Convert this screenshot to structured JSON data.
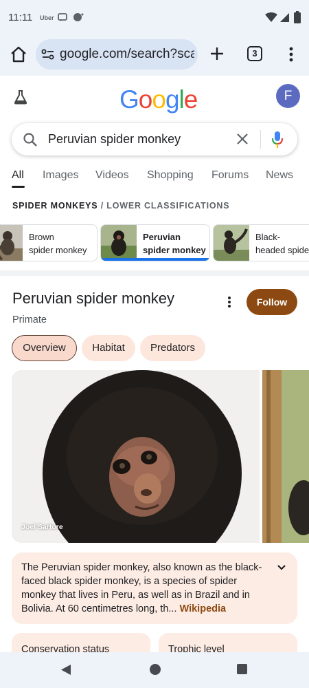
{
  "status_bar": {
    "time": "11:11",
    "app": "Uber"
  },
  "browser": {
    "url": "google.com/search?sca_",
    "tab_count": "3"
  },
  "logo": {
    "letters": [
      {
        "ch": "G",
        "color": "#4285f4"
      },
      {
        "ch": "o",
        "color": "#ea4335"
      },
      {
        "ch": "o",
        "color": "#fbbc05"
      },
      {
        "ch": "g",
        "color": "#4285f4"
      },
      {
        "ch": "l",
        "color": "#34a853"
      },
      {
        "ch": "e",
        "color": "#ea4335"
      }
    ]
  },
  "account": {
    "initial": "F"
  },
  "search": {
    "query": "Peruvian spider monkey"
  },
  "tabs": [
    "All",
    "Images",
    "Videos",
    "Shopping",
    "Forums",
    "News"
  ],
  "breadcrumb": {
    "parent": "SPIDER MONKEYS",
    "separator": "/",
    "current": "LOWER CLASSIFICATIONS"
  },
  "classifications": [
    {
      "line1": "Brown",
      "line2": "spider monkey"
    },
    {
      "line1": "Peruvian",
      "line2": "spider monkey"
    },
    {
      "line1": "Black-",
      "line2": "headed spider"
    }
  ],
  "knowledge_panel": {
    "title": "Peruvian spider monkey",
    "subtitle": "Primate",
    "follow": "Follow",
    "pills": [
      "Overview",
      "Habitat",
      "Predators"
    ],
    "photo_credit": "Joel Sartore",
    "description": "The Peruvian spider monkey, also known as the black-faced black spider monkey, is a species of spider monkey that lives in Peru, as well as in Brazil and in Bolivia. At 60 centimetres long, th",
    "ellipsis": "...",
    "source": "Wikipedia",
    "cards": [
      "Conservation status",
      "Trophic level"
    ]
  },
  "colors": {
    "accent_brown": "#8c4a12",
    "chip_bg": "#fde7dd",
    "selected_bar": "#1a73e8"
  }
}
